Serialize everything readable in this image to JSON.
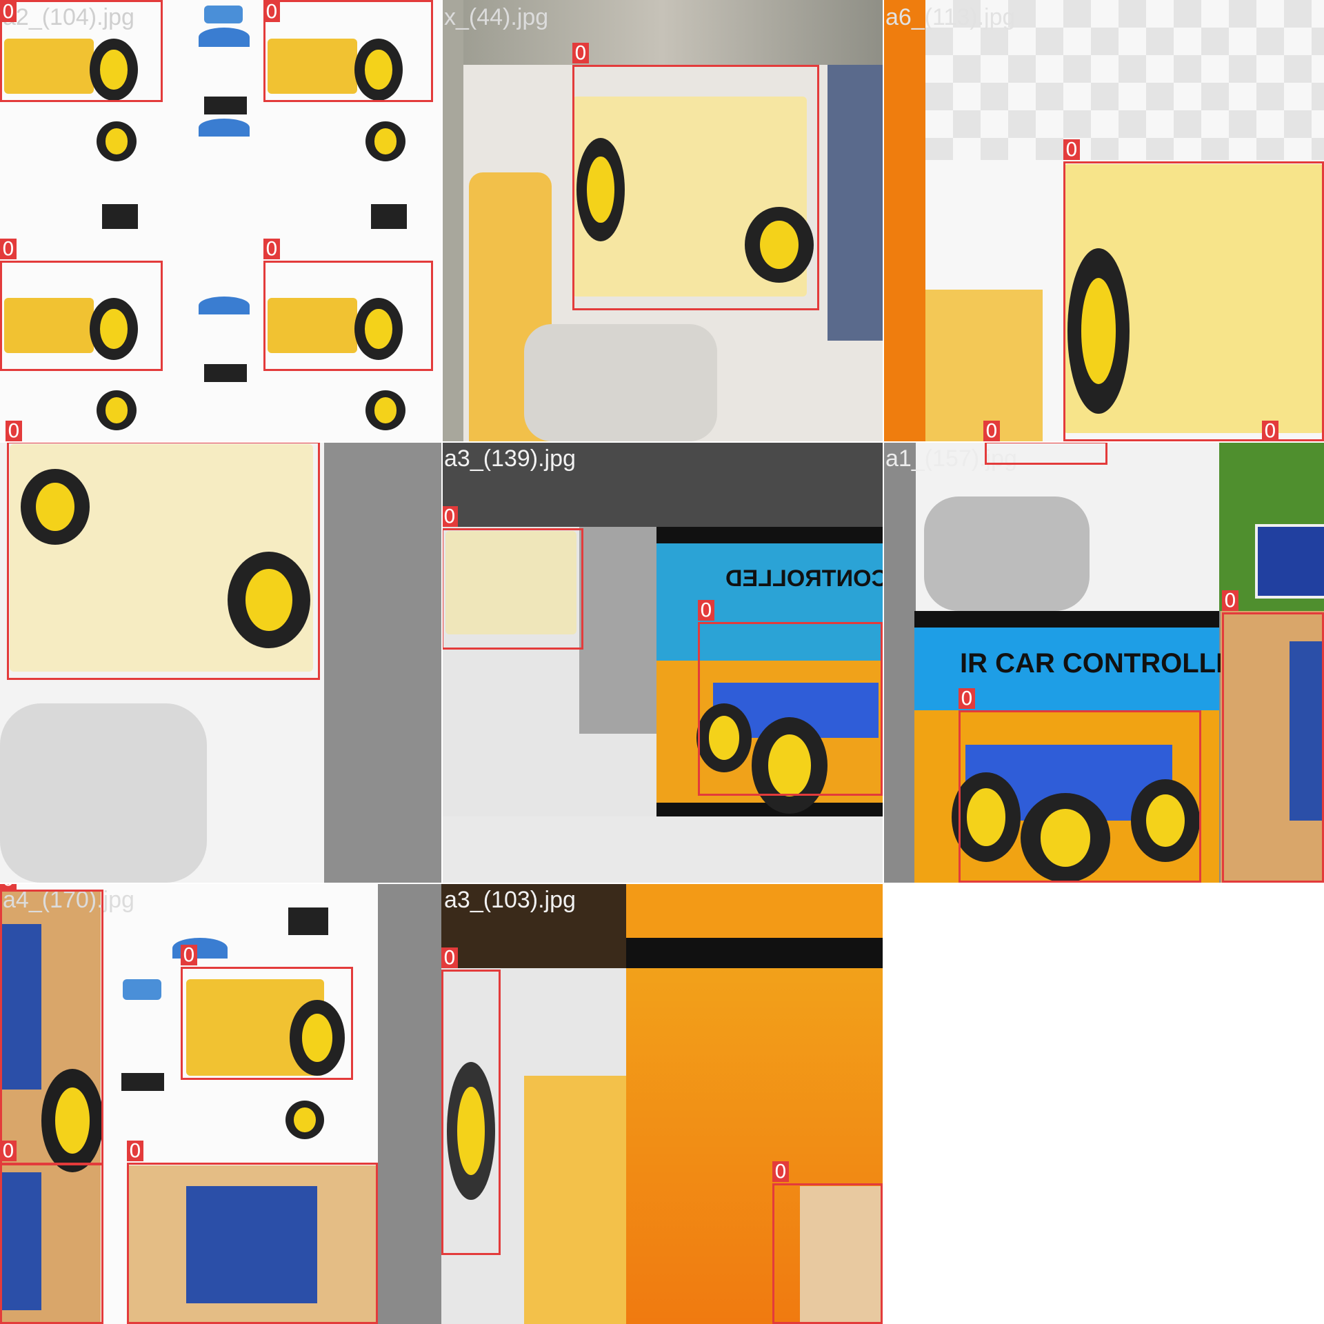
{
  "tiles": [
    {
      "filename": "a2_(104).jpg",
      "class_labels": [
        "0",
        "0",
        "0",
        "0",
        "0"
      ]
    },
    {
      "filename": "x_(44).jpg",
      "class_labels": [
        "0"
      ]
    },
    {
      "filename": "a6_(113).jpg",
      "class_labels": [
        "0",
        "0",
        "0"
      ]
    },
    {
      "filename": "",
      "class_labels": [
        "0"
      ]
    },
    {
      "filename": "a3_(139).jpg",
      "class_labels": [
        "0",
        "0"
      ]
    },
    {
      "filename": "a1_(157).jpg",
      "class_labels": [
        "0",
        "0",
        "0"
      ]
    },
    {
      "filename": "a4_(170).jpg",
      "class_labels": [
        "0",
        "0",
        "0",
        "0"
      ]
    },
    {
      "filename": "a3_(103).jpg",
      "class_labels": [
        "0",
        "0"
      ]
    }
  ],
  "overlay": {
    "cars_tile_texts": [
      "IR CAR CONTROLLED",
      "CAR CONTROLLED"
    ]
  },
  "colors": {
    "box": "#e33b3b"
  }
}
